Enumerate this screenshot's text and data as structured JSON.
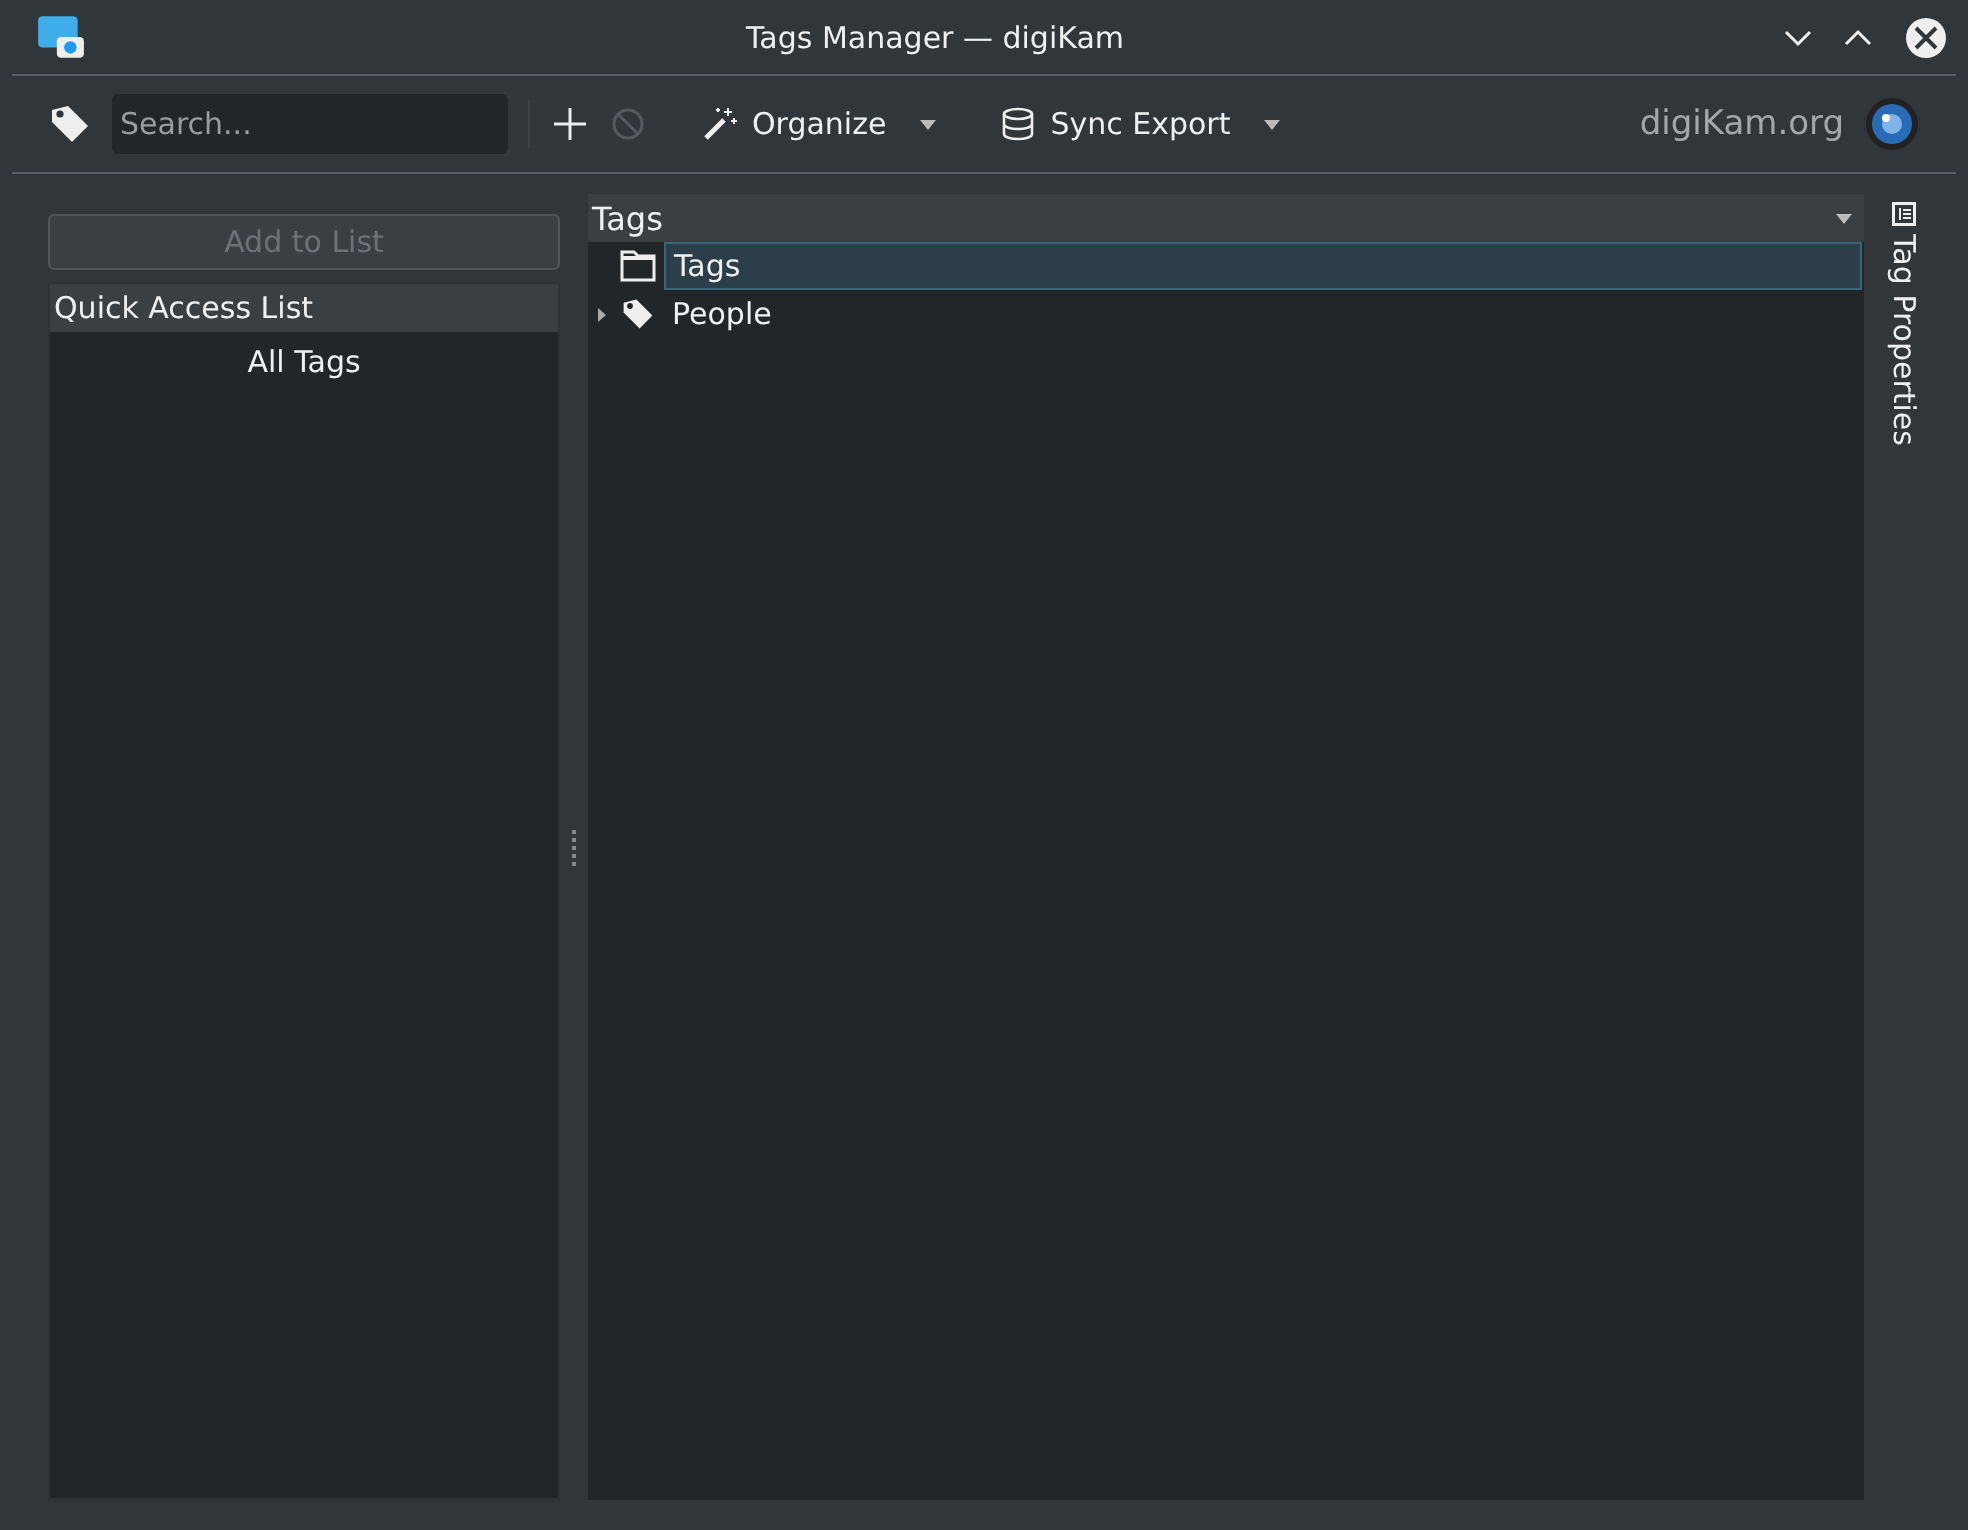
{
  "window": {
    "title": "Tags Manager — digiKam"
  },
  "toolbar": {
    "search": {
      "placeholder": "Search..."
    },
    "remove_disabled": true,
    "buttons": [
      {
        "label": "Organize",
        "kind": "wand"
      },
      {
        "label": "Sync Export",
        "kind": "database"
      }
    ],
    "brand": "digiKam.org"
  },
  "left_panel": {
    "add_button": {
      "label": "Add to List",
      "disabled": true
    },
    "list_header": "Quick Access List",
    "items": [
      {
        "label": "All Tags"
      }
    ]
  },
  "tree": {
    "header": "Tags",
    "items": [
      {
        "label": "Tags",
        "kind": "folder",
        "selected": true
      },
      {
        "label": "People",
        "kind": "tag",
        "selected": false,
        "expanded": false
      }
    ]
  },
  "side_tab": {
    "label": "Tag Properties"
  }
}
